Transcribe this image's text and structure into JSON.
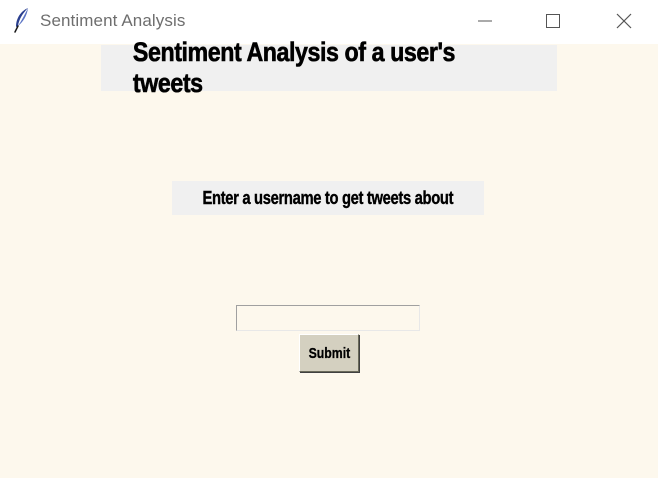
{
  "window": {
    "title": "Sentiment Analysis",
    "icon": "feather-icon",
    "controls": [
      "minimize-icon",
      "maximize-icon",
      "close-icon"
    ]
  },
  "main": {
    "heading": "Sentiment Analysis of a user's tweets",
    "prompt": "Enter a username to get tweets about",
    "username_value": "",
    "submit_label": "Submit"
  },
  "colors": {
    "background": "#fdf8ed",
    "label_background": "#f0f0f0",
    "button_face": "#d4d0c0"
  }
}
